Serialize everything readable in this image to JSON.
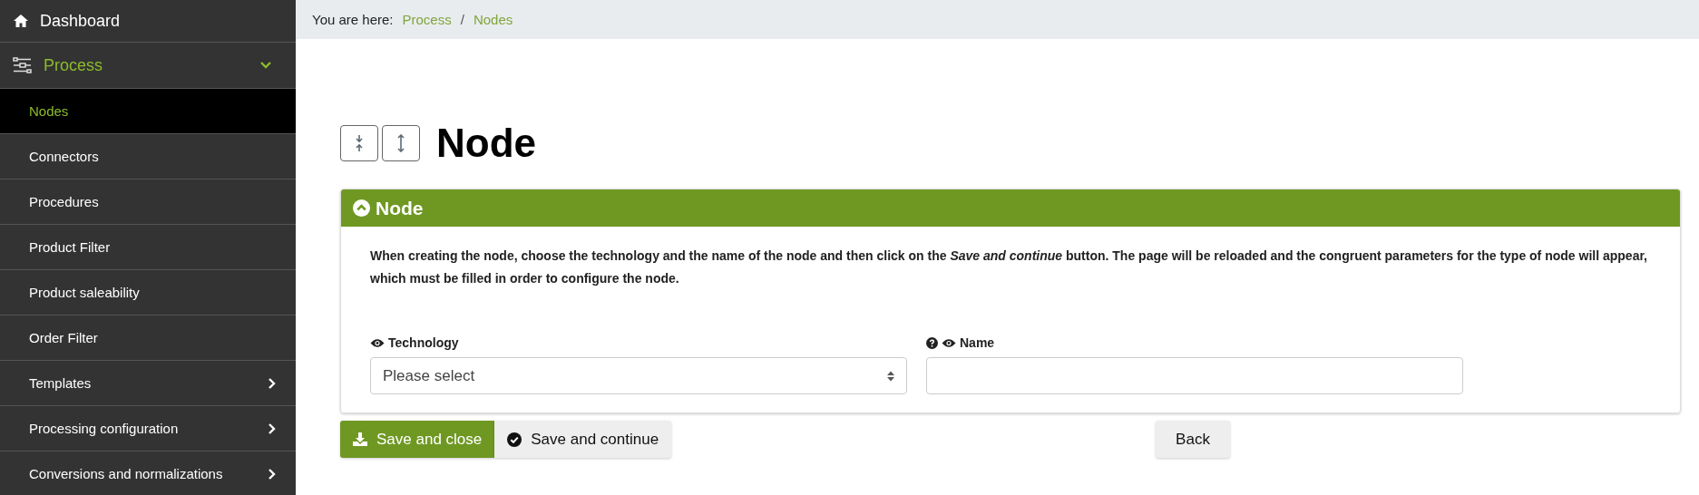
{
  "sidebar": {
    "items": [
      {
        "label": "Dashboard",
        "selected": false
      },
      {
        "label": "Process",
        "selected": true,
        "expanded": true,
        "children": [
          {
            "label": "Nodes",
            "selected": true,
            "has_children": false
          },
          {
            "label": "Connectors",
            "selected": false,
            "has_children": false
          },
          {
            "label": "Procedures",
            "selected": false,
            "has_children": false
          },
          {
            "label": "Product Filter",
            "selected": false,
            "has_children": false
          },
          {
            "label": "Product saleability",
            "selected": false,
            "has_children": false
          },
          {
            "label": "Order Filter",
            "selected": false,
            "has_children": false
          },
          {
            "label": "Templates",
            "selected": false,
            "has_children": true
          },
          {
            "label": "Processing configuration",
            "selected": false,
            "has_children": true
          },
          {
            "label": "Conversions and normalizations",
            "selected": false,
            "has_children": true
          }
        ]
      }
    ]
  },
  "breadcrumb": {
    "prefix": "You are here:",
    "items": [
      "Process",
      "Nodes"
    ],
    "separator": "/"
  },
  "page_title": "Node",
  "panel": {
    "title": "Node",
    "expanded": true,
    "description": "When creating the node, choose the technology and the name of the node and then click on the *Save and continue* button. The page will be reloaded and the congruent parameters for the type of node will appear, which must be filled in order to configure the node.",
    "fields": [
      {
        "label": "Technology",
        "kind": "select",
        "help": false,
        "placeholder": "Please select"
      },
      {
        "label": "Name",
        "kind": "text",
        "help": true
      }
    ]
  },
  "buttons": [
    {
      "label": "Save and close",
      "kind": "primary"
    },
    {
      "label": "Save and continue",
      "kind": "secondary"
    },
    {
      "label": "Back",
      "kind": "back"
    }
  ]
}
